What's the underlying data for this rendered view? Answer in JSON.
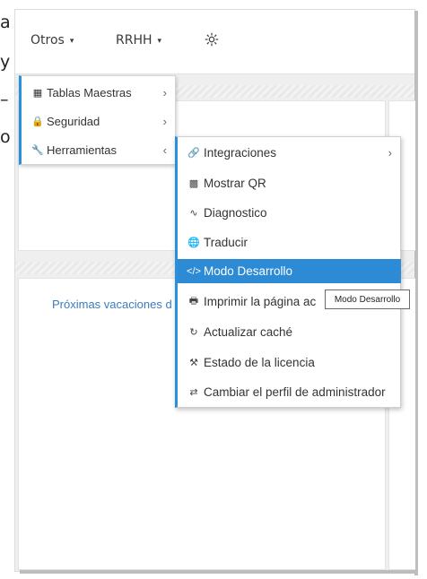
{
  "left_fragments": [
    "a",
    "y",
    "–",
    "o"
  ],
  "navbar": {
    "otros_label": "Otros",
    "rrhh_label": "RRHH",
    "caret": "▾",
    "gear_icon": "gear-icon"
  },
  "menu_level1": {
    "items": [
      {
        "label": "Tablas Maestras",
        "icon": "table-icon",
        "glyph": "▦",
        "chevron": "›"
      },
      {
        "label": "Seguridad",
        "icon": "lock-icon",
        "glyph": "🔒",
        "chevron": "›"
      },
      {
        "label": "Herramientas",
        "icon": "wrench-icon",
        "glyph": "🔧",
        "chevron": "‹"
      }
    ]
  },
  "menu_level2": {
    "items": [
      {
        "label": "Integraciones",
        "icon": "link-icon",
        "glyph": "🔗",
        "chevron": "›"
      },
      {
        "label": "Mostrar QR",
        "icon": "qrcode-icon",
        "glyph": "▩"
      },
      {
        "label": "Diagnostico",
        "icon": "heartbeat-icon",
        "glyph": "∿"
      },
      {
        "label": "Traducir",
        "icon": "globe-icon",
        "glyph": "🌐"
      },
      {
        "label": "Modo Desarrollo",
        "icon": "code-icon",
        "glyph": "</>"
      },
      {
        "label": "Imprimir la página ac",
        "icon": "print-icon",
        "glyph": "🖶"
      },
      {
        "label": "Actualizar caché",
        "icon": "refresh-icon",
        "glyph": "↻"
      },
      {
        "label": "Estado de la licencia",
        "icon": "gavel-icon",
        "glyph": "⚒"
      },
      {
        "label": "Cambiar el perfil de administrador",
        "icon": "exchange-icon",
        "glyph": "⇄"
      }
    ]
  },
  "tooltip": "Modo Desarrollo",
  "content": {
    "proximas_text": "Próximas vacaciones d"
  },
  "colors": {
    "accent": "#2d8bd6",
    "link": "#3c7bbf"
  }
}
